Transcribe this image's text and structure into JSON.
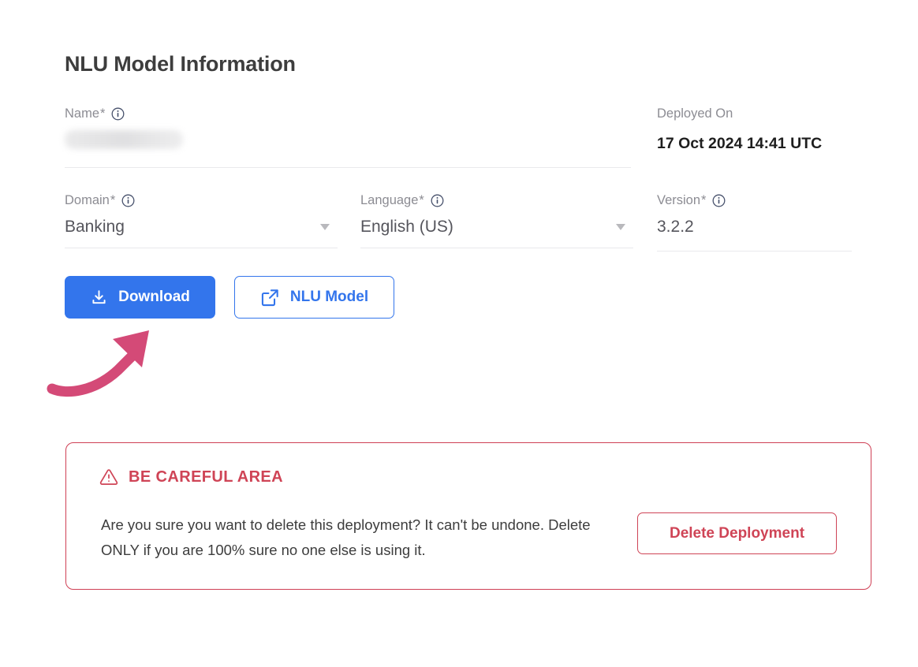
{
  "page": {
    "title": "NLU Model Information",
    "background_color": "#ffffff"
  },
  "colors": {
    "primary_blue": "#3375ec",
    "danger_red": "#cf4456",
    "label_gray": "#8c8c93",
    "value_gray": "#55555c",
    "underline_gray": "#e9e9ec",
    "arrow_pink": "#d44a77"
  },
  "fields": {
    "name": {
      "label": "Name",
      "required_marker": "*",
      "info_icon": "info-circle-icon",
      "value": "",
      "redacted": true
    },
    "deployed_on": {
      "label": "Deployed On",
      "value": "17 Oct 2024 14:41 UTC"
    },
    "domain": {
      "label": "Domain",
      "required_marker": "*",
      "info_icon": "info-circle-icon",
      "value": "Banking",
      "caret_icon": "caret-down-icon"
    },
    "language": {
      "label": "Language",
      "required_marker": "*",
      "info_icon": "info-circle-icon",
      "value": "English (US)",
      "caret_icon": "caret-down-icon"
    },
    "version": {
      "label": "Version",
      "required_marker": "*",
      "info_icon": "info-circle-icon",
      "value": "3.2.2"
    }
  },
  "actions": {
    "download": {
      "label": "Download",
      "icon": "download-icon",
      "style": "filled-blue"
    },
    "nlu_model": {
      "label": "NLU Model",
      "icon": "external-link-icon",
      "style": "outlined-blue"
    }
  },
  "annotation": {
    "arrow": {
      "icon": "curved-arrow-up-right-icon",
      "color": "#d44a77",
      "points_to": "download-button"
    }
  },
  "danger_zone": {
    "heading": "BE CAREFUL AREA",
    "heading_icon": "warning-triangle-icon",
    "body": "Are you sure you want to delete this deployment? It can't be undone. Delete ONLY if you are 100% sure no one else is using it.",
    "delete_button": {
      "label": "Delete Deployment",
      "style": "outlined-red"
    }
  }
}
